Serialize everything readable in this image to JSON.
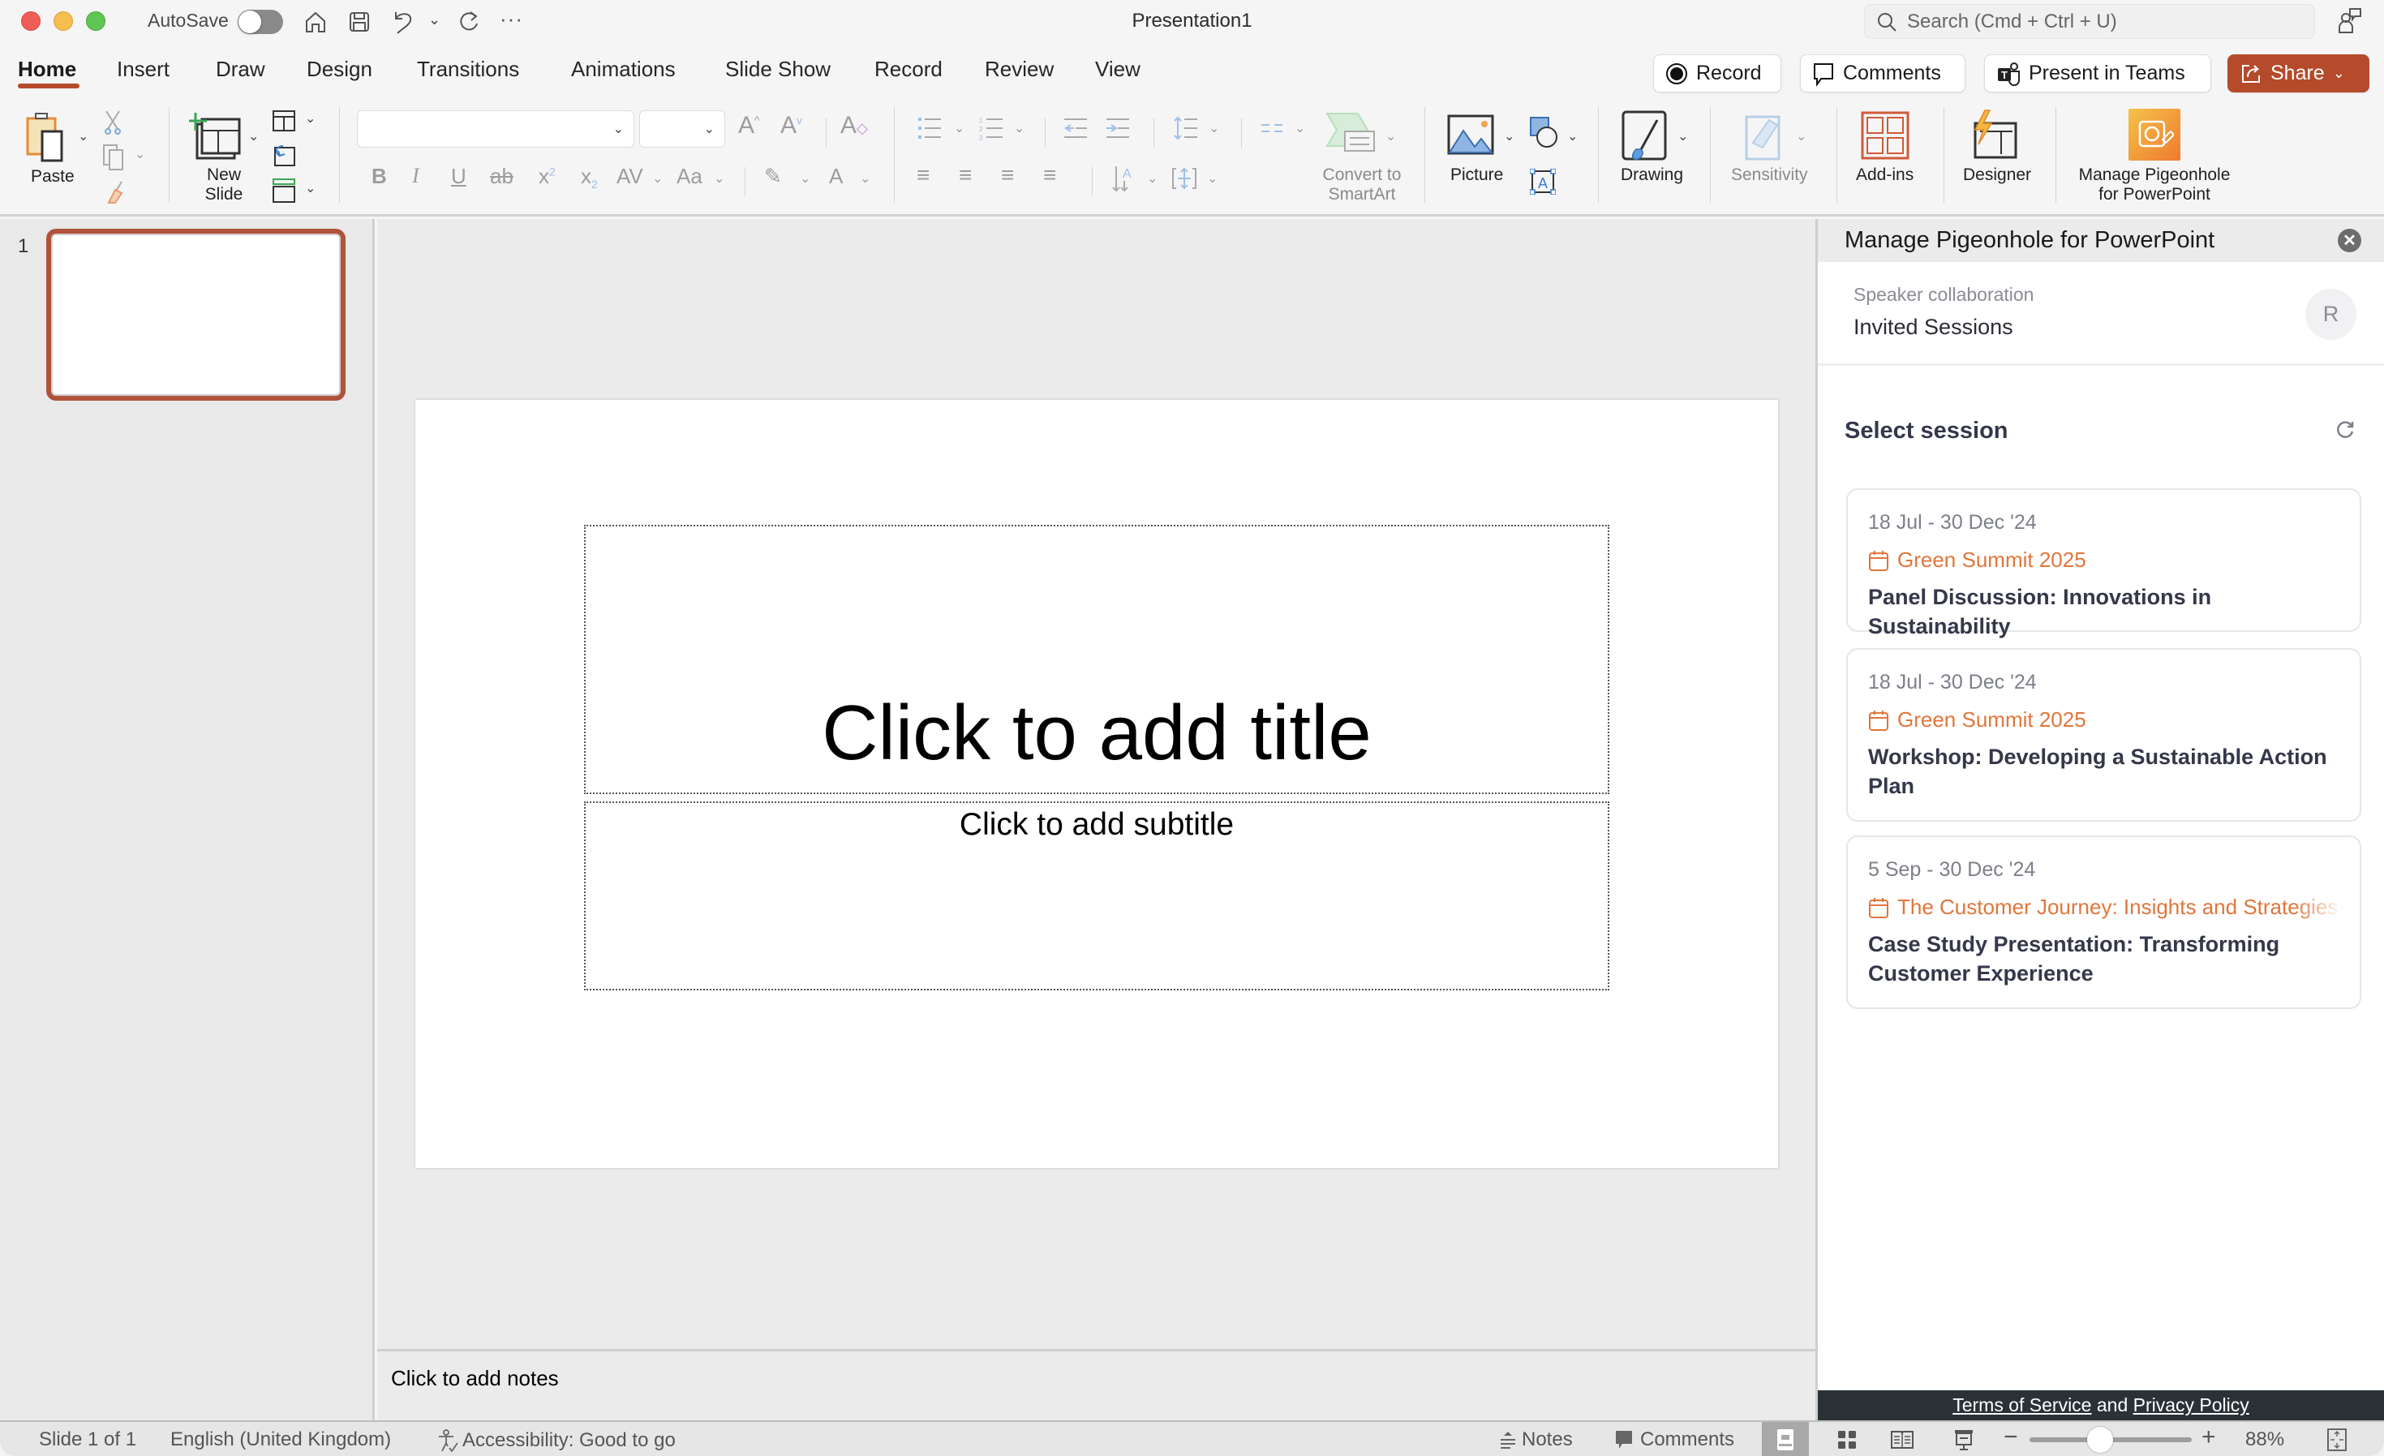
{
  "window": {
    "title": "Presentation1",
    "autosave_label": "AutoSave",
    "autosave_on": false,
    "search_placeholder": "Search (Cmd + Ctrl + U)"
  },
  "tabs": [
    {
      "label": "Home",
      "active": true
    },
    {
      "label": "Insert"
    },
    {
      "label": "Draw"
    },
    {
      "label": "Design"
    },
    {
      "label": "Transitions"
    },
    {
      "label": "Animations"
    },
    {
      "label": "Slide Show"
    },
    {
      "label": "Record"
    },
    {
      "label": "Review"
    },
    {
      "label": "View"
    }
  ],
  "top_buttons": {
    "record": "Record",
    "comments": "Comments",
    "present_teams": "Present in Teams",
    "share": "Share"
  },
  "ribbon": {
    "paste": "Paste",
    "new_slide_line1": "New",
    "new_slide_line2": "Slide",
    "font_name": "",
    "font_size": "",
    "convert_smartart_line1": "Convert to",
    "convert_smartart_line2": "SmartArt",
    "picture": "Picture",
    "drawing": "Drawing",
    "sensitivity": "Sensitivity",
    "addins": "Add-ins",
    "designer": "Designer",
    "pigeonhole_line1": "Manage Pigeonhole",
    "pigeonhole_line2": "for PowerPoint"
  },
  "sidebar": {
    "slides": [
      {
        "number": "1"
      }
    ]
  },
  "slide": {
    "title_placeholder": "Click to add title",
    "subtitle_placeholder": "Click to add subtitle"
  },
  "notes": {
    "placeholder": "Click to add notes"
  },
  "statusbar": {
    "slide_count": "Slide 1 of 1",
    "language": "English (United Kingdom)",
    "accessibility": "Accessibility: Good to go",
    "notes": "Notes",
    "comments": "Comments",
    "zoom_percent": "88%",
    "zoom_value": 88
  },
  "panel": {
    "title": "Manage Pigeonhole for PowerPoint",
    "collab_label": "Speaker collaboration",
    "collab_value": "Invited Sessions",
    "avatar_initial": "R",
    "select_title": "Select session",
    "sessions": [
      {
        "date": "18 Jul - 30 Dec '24",
        "event": "Green Summit 2025",
        "title": "Panel Discussion: Innovations in Sustainability"
      },
      {
        "date": "18 Jul - 30 Dec '24",
        "event": "Green Summit 2025",
        "title": "Workshop: Developing a Sustainable Action Plan"
      },
      {
        "date": "5 Sep - 30 Dec '24",
        "event": "The Customer Journey: Insights and Strategies",
        "title": "Case Study Presentation: Transforming Customer Experience"
      }
    ],
    "terms_link": "Terms of Service",
    "terms_and": " and ",
    "privacy_link": "Privacy Policy"
  },
  "colors": {
    "accent": "#b54b2b",
    "event_orange": "#e0763b",
    "terms_bar": "#2a3237"
  }
}
